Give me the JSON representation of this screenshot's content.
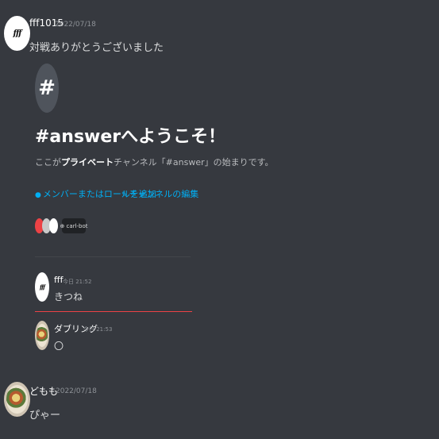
{
  "messages": [
    {
      "username": "fff1015",
      "timestamp": "2022/07/18",
      "text": "対戦ありがとうございました",
      "avatar_text": "fff"
    },
    {
      "username": "どもも",
      "timestamp": "2022/07/18",
      "text": "ぴゃー"
    }
  ],
  "embed": {
    "hash_icon": "#",
    "title": "#answerへようこそ！",
    "subtitle_prefix": "ここが",
    "subtitle_bold": "プライベート",
    "subtitle_suffix": "チャンネル「#answer」の始まりです。",
    "link_add_member": "メンバーまたはロールを追加",
    "link_edit_channel": "チャンネルの編集",
    "bot_badge": "⊕ carl-bot",
    "member_colors": [
      "#ed4245",
      "#c9c9c9",
      "#ffffff"
    ],
    "inner_messages": [
      {
        "username": "fff",
        "timestamp": "今日 21:52",
        "text": "きつね",
        "avatar_text": "fff"
      },
      {
        "username": "ダブリング",
        "timestamp": "今日 21:53",
        "text": "〇"
      }
    ]
  }
}
